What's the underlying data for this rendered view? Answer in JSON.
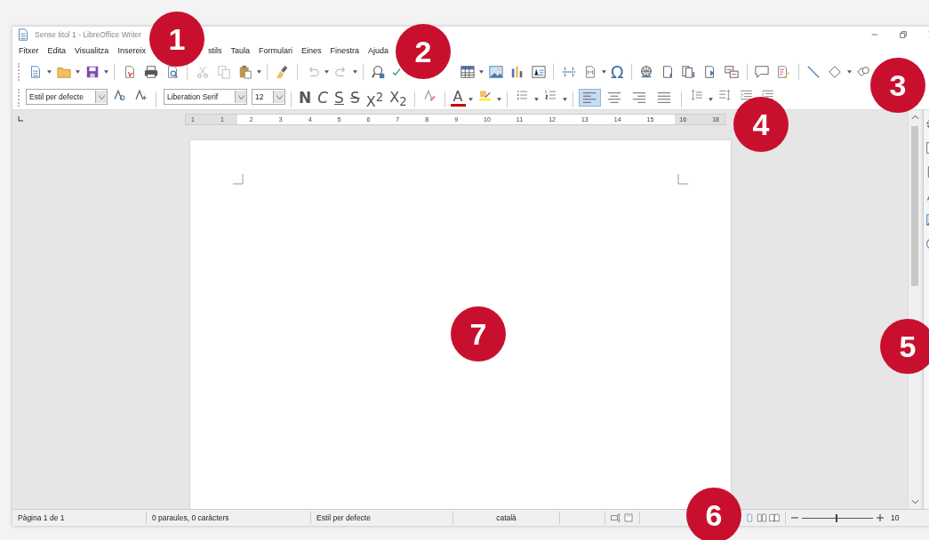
{
  "window": {
    "title": "Sense titol 1 - LibreOffice Writer"
  },
  "menu": [
    "Fitxer",
    "Edita",
    "Visualitza",
    "Insereix",
    "stils",
    "Taula",
    "Formulari",
    "Eines",
    "Finestra",
    "Ajuda"
  ],
  "standard_toolbar": {
    "special_character": "Ω"
  },
  "format_toolbar": {
    "paragraph_style": "Estil per defecte",
    "font_name": "Liberation Serif",
    "font_size": "12",
    "text_buttons": [
      {
        "label": "N",
        "kind": "bold"
      },
      {
        "label": "C",
        "kind": "italic"
      },
      {
        "label": "S",
        "kind": "underline"
      },
      {
        "label": "S",
        "kind": "strike"
      },
      {
        "label": "X$^{2}$",
        "kind": "plain"
      },
      {
        "label": "X$_{2}$",
        "kind": "plain"
      }
    ],
    "font_color": "A",
    "alignment": [
      {
        "kind": "left",
        "selected": true
      },
      {
        "kind": "center",
        "selected": false
      },
      {
        "kind": "right",
        "selected": false
      },
      {
        "kind": "justify",
        "selected": false
      }
    ]
  },
  "ruler": {
    "labels": [
      "1",
      "1",
      "2",
      "3",
      "4",
      "5",
      "6",
      "7",
      "8",
      "9",
      "10",
      "11",
      "12",
      "13",
      "14",
      "15",
      "16",
      "18"
    ]
  },
  "status_bar": {
    "fields": [
      "Pàgina 1 de 1",
      "0 paraules, 0 caràcters",
      "Estil per defecte",
      "català"
    ],
    "zoom": {
      "level": 0.47,
      "reading": "10"
    }
  },
  "callouts": [
    {
      "number": "1"
    },
    {
      "number": "2"
    },
    {
      "number": "3"
    },
    {
      "number": "4"
    },
    {
      "number": "5"
    },
    {
      "number": "6"
    },
    {
      "number": "7"
    }
  ]
}
